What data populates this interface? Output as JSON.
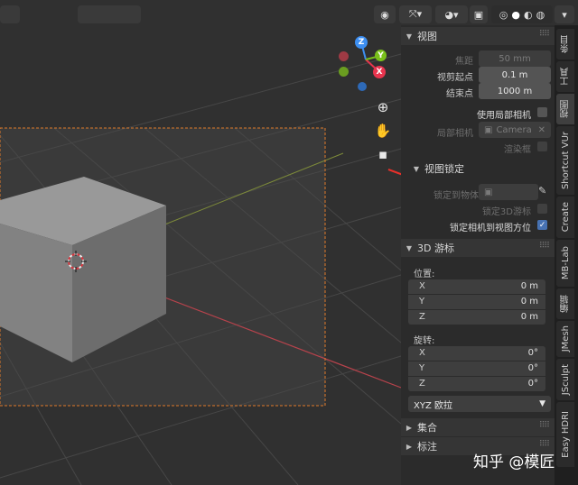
{
  "tabs": [
    {
      "label": "条目",
      "active": false
    },
    {
      "label": "工具",
      "active": false
    },
    {
      "label": "视图",
      "active": true
    },
    {
      "label": "Shortcut VUr",
      "active": false
    },
    {
      "label": "Create",
      "active": false
    },
    {
      "label": "MB-Lab",
      "active": false
    },
    {
      "label": "编辑",
      "active": false
    },
    {
      "label": "JMesh",
      "active": false
    },
    {
      "label": "JSculpt",
      "active": false
    },
    {
      "label": "Easy HDRI",
      "active": false
    }
  ],
  "gizmo": {
    "z": "Z",
    "y": "Y",
    "x": "X"
  },
  "view_panel": {
    "title": "视图",
    "focal_label": "焦距",
    "focal_value": "50 mm",
    "clip_start_label": "视剪起点",
    "clip_start_value": "0.1 m",
    "clip_end_label": "结束点",
    "clip_end_value": "1000 m",
    "local_camera_check_label": "使用局部相机",
    "local_camera_label": "局部相机",
    "local_camera_value": "Camera",
    "render_region_label": "渲染框"
  },
  "view_lock": {
    "title": "视图锁定",
    "lock_object_label": "锁定到物体",
    "lock_cursor_label": "锁定3D游标",
    "lock_camera_label": "锁定相机到视图方位",
    "lock_camera_checked": true
  },
  "cursor_panel": {
    "title": "3D 游标",
    "location_label": "位置:",
    "location": [
      {
        "axis": "X",
        "value": "0 m"
      },
      {
        "axis": "Y",
        "value": "0 m"
      },
      {
        "axis": "Z",
        "value": "0 m"
      }
    ],
    "rotation_label": "旋转:",
    "rotation": [
      {
        "axis": "X",
        "value": "0°"
      },
      {
        "axis": "Y",
        "value": "0°"
      },
      {
        "axis": "Z",
        "value": "0°"
      }
    ],
    "rotation_mode": "XYZ 欧拉"
  },
  "collections_title": "集合",
  "annotations_title": "标注",
  "watermark": "知乎 @模匠",
  "colors": {
    "axis_x": "#e8344e",
    "axis_y": "#79c01a",
    "axis_z": "#3d8ff2",
    "accent": "#4772b3",
    "arrow": "#e8302a"
  }
}
